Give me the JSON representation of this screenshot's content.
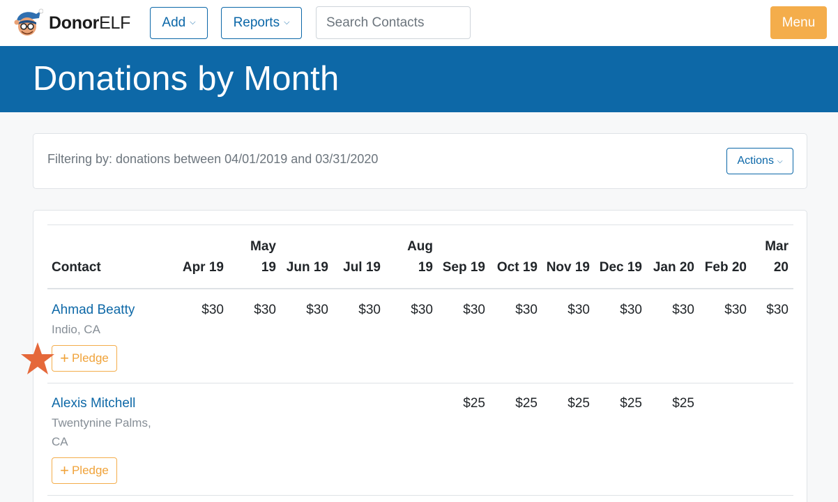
{
  "brand": {
    "name_bold": "Donor",
    "name_light": "ELF"
  },
  "nav": {
    "add_label": "Add",
    "reports_label": "Reports",
    "search_placeholder": "Search Contacts",
    "menu_label": "Menu"
  },
  "page": {
    "title": "Donations by Month"
  },
  "filter": {
    "text": "Filtering by: donations between 04/01/2019 and 03/31/2020",
    "actions_label": "Actions"
  },
  "table": {
    "contact_header": "Contact",
    "months": [
      [
        "",
        "Apr 19"
      ],
      [
        "May",
        "19"
      ],
      [
        "",
        "Jun 19"
      ],
      [
        "",
        "Jul 19"
      ],
      [
        "Aug",
        "19"
      ],
      [
        "",
        "Sep 19"
      ],
      [
        "",
        "Oct 19"
      ],
      [
        "",
        "Nov 19"
      ],
      [
        "",
        "Dec 19"
      ],
      [
        "",
        "Jan 20"
      ],
      [
        "",
        "Feb 20"
      ],
      [
        "Mar",
        "20"
      ]
    ],
    "rows": [
      {
        "name": "Ahmad Beatty",
        "location": "Indio, CA",
        "pledge_label": "Pledge",
        "amounts": [
          "$30",
          "$30",
          "$30",
          "$30",
          "$30",
          "$30",
          "$30",
          "$30",
          "$30",
          "$30",
          "$30",
          "$30"
        ]
      },
      {
        "name": "Alexis Mitchell",
        "location": "Twentynine Palms, CA",
        "pledge_label": "Pledge",
        "amounts": [
          "",
          "",
          "",
          "",
          "",
          "$25",
          "$25",
          "$25",
          "$25",
          "$25",
          "",
          ""
        ]
      }
    ]
  },
  "colors": {
    "primary": "#0d68a7",
    "accent_orange": "#f4ad4b",
    "star": "#e5683a"
  },
  "icons": [
    "mascot-logo-icon",
    "chevron-down-icon",
    "plus-icon",
    "star-icon"
  ]
}
